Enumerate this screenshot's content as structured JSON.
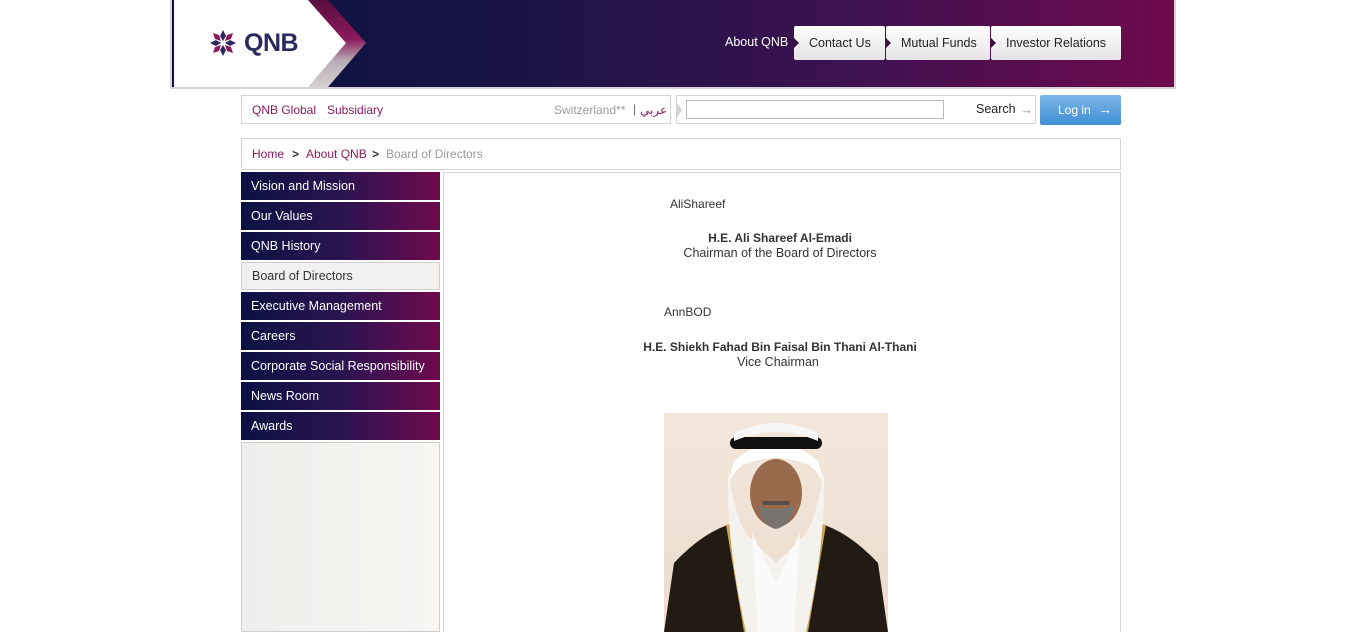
{
  "header": {
    "logo_text": "QNB",
    "nav_about": "About QNB",
    "nav_tabs": [
      "Contact Us",
      "Mutual Funds",
      "Investor Relations"
    ],
    "colors": {
      "brand_dark": "#0b1240",
      "brand_maroon": "#6e0a4e",
      "link": "#8a1a5c"
    }
  },
  "utility": {
    "global_link": "QNB Global",
    "subsidiary_link": "Subsidiary",
    "country": "Switzerland**",
    "separator": "|",
    "arabic_link": "عربي",
    "search_value": "",
    "search_label": "Search",
    "search_icon": "arrow-right-icon",
    "login_label": "Log in",
    "login_icon": "arrow-right-icon"
  },
  "breadcrumb": {
    "home": "Home",
    "sep": ">",
    "about": "About QNB",
    "current": "Board of Directors"
  },
  "sidebar": {
    "items": [
      {
        "label": "Vision and Mission"
      },
      {
        "label": "Our Values"
      },
      {
        "label": "QNB History"
      },
      {
        "label": "Board of Directors",
        "active": true
      },
      {
        "label": "Executive Management"
      },
      {
        "label": "Careers"
      },
      {
        "label": "Corporate Social Responsibility"
      },
      {
        "label": "News Room"
      },
      {
        "label": "Awards"
      }
    ]
  },
  "content": {
    "members": [
      {
        "image_alt": "AliShareef",
        "name": "H.E. Ali Shareef Al-Emadi",
        "role": "Chairman of the Board of Directors"
      },
      {
        "image_alt": "AnnBOD",
        "name": "H.E. Shiekh Fahad Bin Faisal Bin Thani Al-Thani",
        "role": "Vice Chairman"
      }
    ]
  }
}
